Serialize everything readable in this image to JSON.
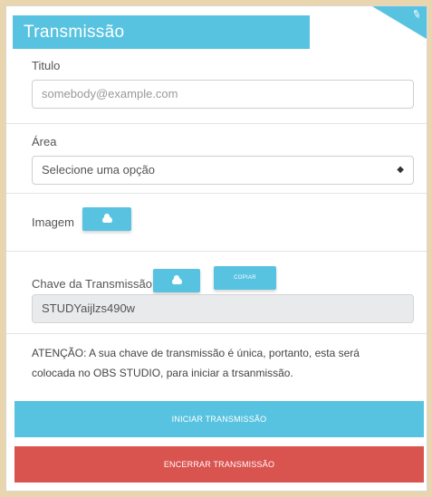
{
  "header": {
    "title": "Transmissão"
  },
  "form": {
    "titulo": {
      "label": "Titulo",
      "placeholder": "somebody@example.com"
    },
    "area": {
      "label": "Área",
      "selected": "Selecione uma opção"
    },
    "imagem": {
      "label": "Imagem"
    },
    "chave": {
      "label": "Chave da Transmissão",
      "copy_label": "COPIAR",
      "value": "STUDYaijlzs490w"
    },
    "warning": "ATENÇÃO: A sua chave de transmissão é única, portanto, esta será colocada no OBS STUDIO, para iniciar a trsanmissão."
  },
  "actions": {
    "start": "INICIAR TRANSMISSÃO",
    "stop": "ENCERRAR TRANSMISSÃO"
  },
  "colors": {
    "accent": "#58c3e1",
    "danger": "#d9534f",
    "background": "#e9d6ae"
  },
  "icons": {
    "upload": "cloud-upload-icon",
    "edit": "pencil-icon"
  }
}
